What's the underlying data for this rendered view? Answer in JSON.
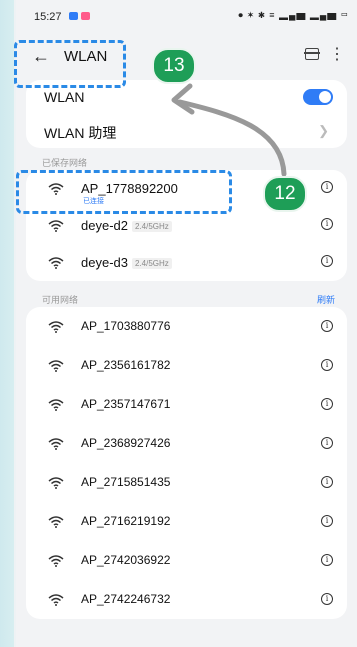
{
  "status_bar": {
    "time": "15:27",
    "right_indicators": "⏺ ✶ ✱ ≡ ▂▄▆ ▂▄▆ ▭"
  },
  "app_bar": {
    "back_icon": "arrow-left-icon",
    "title": "WLAN",
    "scan_icon": "scan-icon",
    "more_icon": "more-vertical-icon"
  },
  "settings": [
    {
      "label": "WLAN",
      "control": "toggle",
      "value": "on"
    },
    {
      "label": "WLAN 助理",
      "control": "chevron"
    }
  ],
  "saved_section": {
    "title": "已保存网络",
    "networks": [
      {
        "name": "AP_1778892200",
        "status": "已连接",
        "band": ""
      },
      {
        "name": "deye-d2",
        "band": "2.4/5GHz"
      },
      {
        "name": "deye-d3",
        "band": "2.4/5GHz"
      }
    ]
  },
  "available_section": {
    "title": "可用网络",
    "refresh_label": "刷新",
    "networks": [
      {
        "name": "AP_1703880776"
      },
      {
        "name": "AP_2356161782"
      },
      {
        "name": "AP_2357147671"
      },
      {
        "name": "AP_2368927426"
      },
      {
        "name": "AP_2715851435"
      },
      {
        "name": "AP_2716219192"
      },
      {
        "name": "AP_2742036922"
      },
      {
        "name": "AP_2742246732"
      }
    ]
  },
  "annotations": {
    "step_12": "12",
    "step_13": "13"
  },
  "colors": {
    "accent": "#2f7cf6",
    "badge": "#1e9e57",
    "annotation_box": "#2a8ae6"
  }
}
